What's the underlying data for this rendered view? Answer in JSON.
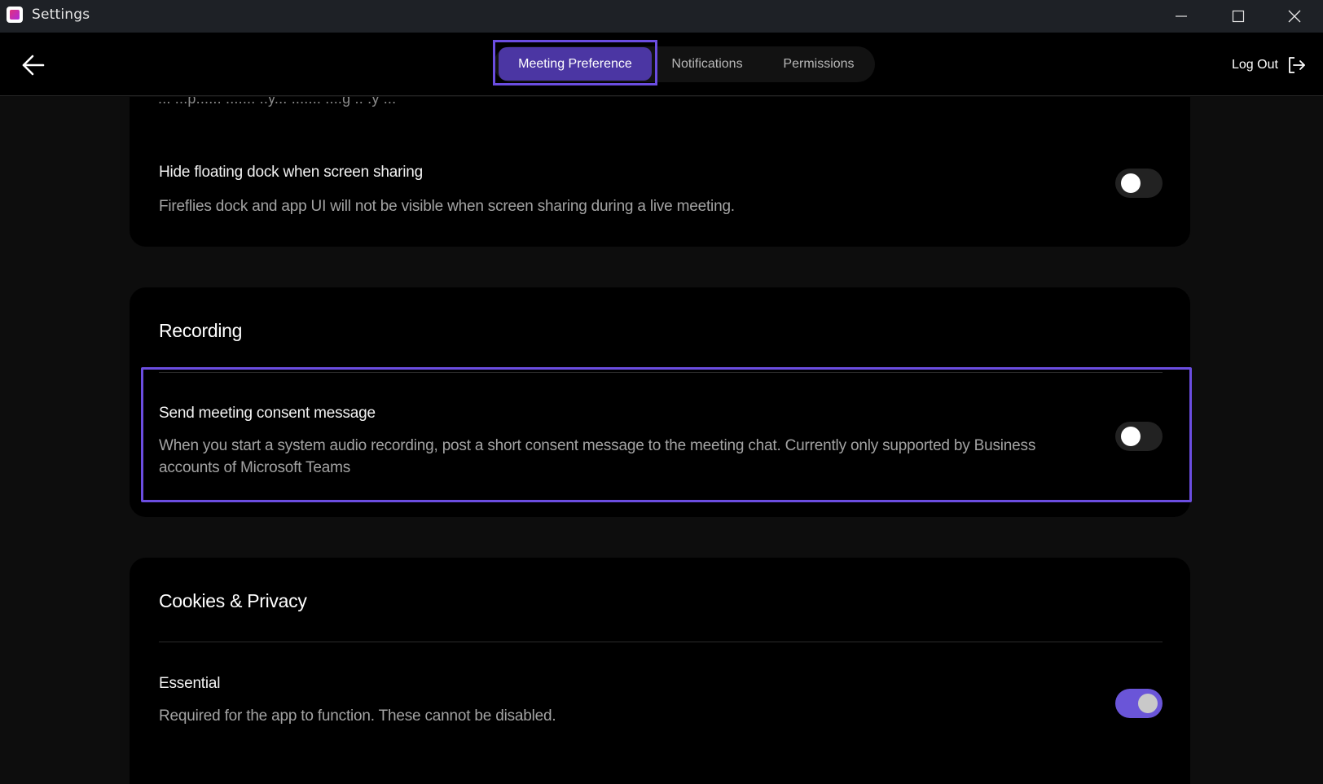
{
  "window": {
    "title": "Settings",
    "app_icon": "fireflies-logo-icon",
    "controls": [
      "minimize-icon",
      "maximize-icon",
      "close-icon"
    ]
  },
  "header": {
    "back_icon": "arrow-left-icon",
    "tabs": [
      {
        "label": "Meeting Preference",
        "active": true
      },
      {
        "label": "Notifications",
        "active": false
      },
      {
        "label": "Permissions",
        "active": false
      }
    ],
    "logout": {
      "label": "Log Out",
      "icon": "logout-icon"
    }
  },
  "sections": {
    "top": {
      "cut_off_text": "... ...p...... ....... ..y... ....... ....g ..  .y ...",
      "settings": [
        {
          "title": "Hide floating dock when screen sharing",
          "description": "Fireflies dock and app UI will not be visible when screen sharing during a live meeting.",
          "enabled": false
        }
      ]
    },
    "recording": {
      "title": "Recording",
      "settings": [
        {
          "title": "Send meeting consent message",
          "description": "When you start a system audio recording, post a short consent message to the meeting chat. Currently only supported by Business accounts of Microsoft Teams",
          "enabled": false
        }
      ]
    },
    "cookies": {
      "title": "Cookies & Privacy",
      "settings": [
        {
          "title": "Essential",
          "description": "Required for the app to function. These cannot be disabled.",
          "enabled": true
        }
      ]
    }
  },
  "colors": {
    "accent": "#6b4de0",
    "active_tab": "#4b36a3",
    "toggle_on": "#6a55d8",
    "background": "#0d0d0d",
    "card": "#000000"
  }
}
